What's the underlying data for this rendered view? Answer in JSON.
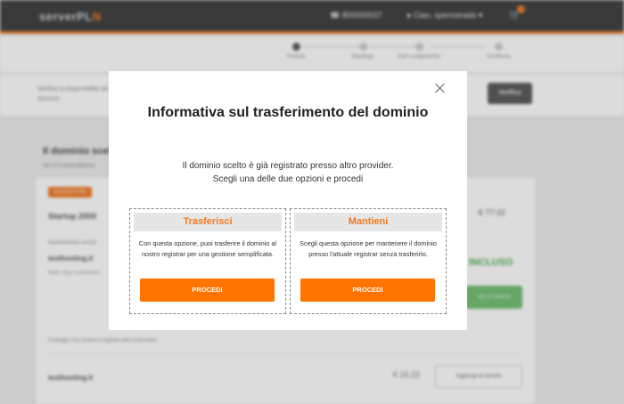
{
  "header": {
    "logo_text_a": "serverPL",
    "logo_text_b": "N",
    "phone": "800000037",
    "user": "Ciao, spencerado",
    "accent": "#f07a22"
  },
  "steps": [
    {
      "label": "Prodotti"
    },
    {
      "label": "Riepilogo"
    },
    {
      "label": "Dati e pagamento"
    },
    {
      "label": "Conferma"
    }
  ],
  "search": {
    "text": "Verifica la disponibilità del dominio",
    "button": "Verifica"
  },
  "page": {
    "title": "Il dominio scelto",
    "subtitle": "Se vi il prenotiamo",
    "tag": "SUGGESTIONS",
    "product_name": "Startup 2000",
    "product_price": "€ 77.02",
    "line1": "Naviamnento servizi",
    "domain": "testhosting.it",
    "line3": "Nello step successivo",
    "included": "INCLUSO",
    "green_button": "Vai al dominio",
    "protect_text": "Proteggi il tuo brand e registra altre estensioni",
    "alt_domain": "testhosting.it",
    "alt_price": "€ 15.22",
    "add_button": "Aggiungi al carrello"
  },
  "modal": {
    "title": "Informativa sul trasferimento del dominio",
    "desc_line1": "Il dominio scelto è già registrato presso altro provider.",
    "desc_line2": "Scegli una delle due opzioni e procedi",
    "options": [
      {
        "title": "Trasferisci",
        "body": "Con questa opzione, puoi trasferire il dominio al nostro registrar per una gestione semplificata.",
        "button": "PROCEDI"
      },
      {
        "title": "Mantieni",
        "body": "Scegli questa opzione per mantenere il dominio presso l'attuale registrar senza trasferirlo.",
        "button": "PROCEDI"
      }
    ],
    "button_color": "#ff7300"
  }
}
